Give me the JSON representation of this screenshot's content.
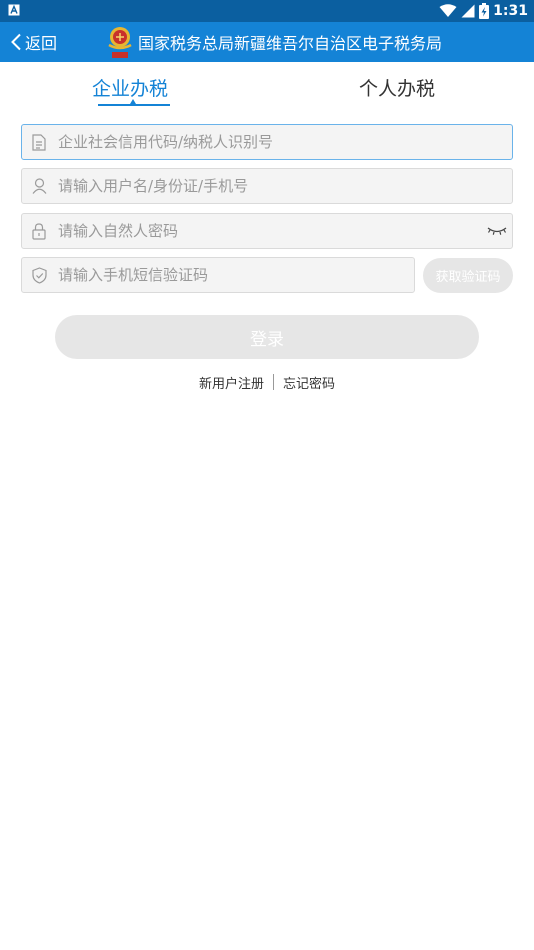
{
  "status_bar": {
    "time": "1:31",
    "left_icon": "a-box-icon",
    "right_icons": [
      "wifi-icon",
      "signal-icon",
      "battery-icon"
    ]
  },
  "header": {
    "back_label": "返回",
    "title": "国家税务总局新疆维吾尔自治区电子税务局",
    "emblem": "tax-emblem-icon"
  },
  "tabs": [
    {
      "label": "企业办税",
      "active": true
    },
    {
      "label": "个人办税",
      "active": false
    }
  ],
  "form": {
    "credit_code_placeholder": "企业社会信用代码/纳税人识别号",
    "username_placeholder": "请输入用户名/身份证/手机号",
    "password_placeholder": "请输入自然人密码",
    "sms_code_placeholder": "请输入手机短信验证码",
    "get_code_label": "获取验证码",
    "login_label": "登录"
  },
  "links": {
    "register": "新用户注册",
    "forgot": "忘记密码"
  },
  "colors": {
    "header_blue": "#1483d6",
    "status_bar_blue": "#0b5fa0",
    "disabled_button": "#e6e6e6"
  }
}
